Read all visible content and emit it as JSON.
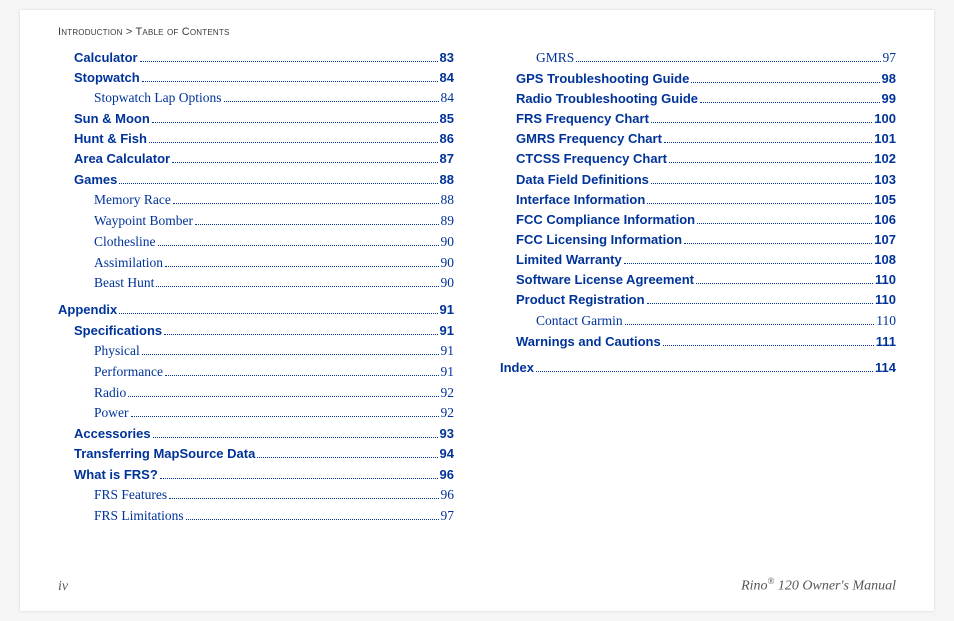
{
  "header": {
    "left": "Introduction",
    "right": "Table of Contents"
  },
  "footer": {
    "page": "iv",
    "product_prefix": "Rino",
    "reg": "®",
    "product_suffix": " 120 Owner's Manual"
  },
  "toc": [
    {
      "level": 1,
      "label": "Calculator",
      "page": "83"
    },
    {
      "level": 1,
      "label": "Stopwatch",
      "page": "84"
    },
    {
      "level": 2,
      "label": "Stopwatch Lap Options",
      "page": "84"
    },
    {
      "level": 1,
      "label": "Sun & Moon",
      "page": "85"
    },
    {
      "level": 1,
      "label": "Hunt & Fish",
      "page": "86"
    },
    {
      "level": 1,
      "label": "Area Calculator",
      "page": "87"
    },
    {
      "level": 1,
      "label": "Games",
      "page": "88"
    },
    {
      "level": 2,
      "label": "Memory Race",
      "page": "88"
    },
    {
      "level": 2,
      "label": "Waypoint Bomber",
      "page": "89"
    },
    {
      "level": 2,
      "label": "Clothesline",
      "page": "90"
    },
    {
      "level": 2,
      "label": "Assimilation",
      "page": "90"
    },
    {
      "level": 2,
      "label": "Beast Hunt",
      "page": "90"
    },
    {
      "level": 0,
      "label": "Appendix",
      "page": "91"
    },
    {
      "level": 1,
      "label": "Specifications",
      "page": "91"
    },
    {
      "level": 2,
      "label": "Physical",
      "page": "91"
    },
    {
      "level": 2,
      "label": "Performance",
      "page": "91"
    },
    {
      "level": 2,
      "label": "Radio",
      "page": "92"
    },
    {
      "level": 2,
      "label": "Power",
      "page": "92"
    },
    {
      "level": 1,
      "label": "Accessories",
      "page": "93"
    },
    {
      "level": 1,
      "label": "Transferring MapSource Data",
      "page": "94"
    },
    {
      "level": 1,
      "label": "What is FRS?",
      "page": "96"
    },
    {
      "level": 2,
      "label": "FRS Features",
      "page": "96"
    },
    {
      "level": 2,
      "label": "FRS Limitations",
      "page": "97"
    },
    {
      "level": 2,
      "label": "GMRS",
      "page": "97",
      "colbreak": true
    },
    {
      "level": 1,
      "label": "GPS Troubleshooting Guide",
      "page": "98"
    },
    {
      "level": 1,
      "label": "Radio Troubleshooting Guide",
      "page": "99"
    },
    {
      "level": 1,
      "label": "FRS Frequency Chart",
      "page": "100"
    },
    {
      "level": 1,
      "label": "GMRS Frequency Chart",
      "page": "101"
    },
    {
      "level": 1,
      "label": "CTCSS Frequency Chart",
      "page": "102"
    },
    {
      "level": 1,
      "label": "Data Field Definitions",
      "page": "103"
    },
    {
      "level": 1,
      "label": "Interface Information",
      "page": "105"
    },
    {
      "level": 1,
      "label": "FCC Compliance Information",
      "page": "106"
    },
    {
      "level": 1,
      "label": "FCC Licensing Information",
      "page": "107"
    },
    {
      "level": 1,
      "label": "Limited Warranty",
      "page": "108"
    },
    {
      "level": 1,
      "label": "Software License Agreement",
      "page": "110"
    },
    {
      "level": 1,
      "label": "Product Registration",
      "page": "110"
    },
    {
      "level": 2,
      "label": "Contact Garmin",
      "page": "110"
    },
    {
      "level": 1,
      "label": "Warnings and Cautions",
      "page": "111"
    },
    {
      "level": 0,
      "label": "Index",
      "page": "114"
    }
  ]
}
